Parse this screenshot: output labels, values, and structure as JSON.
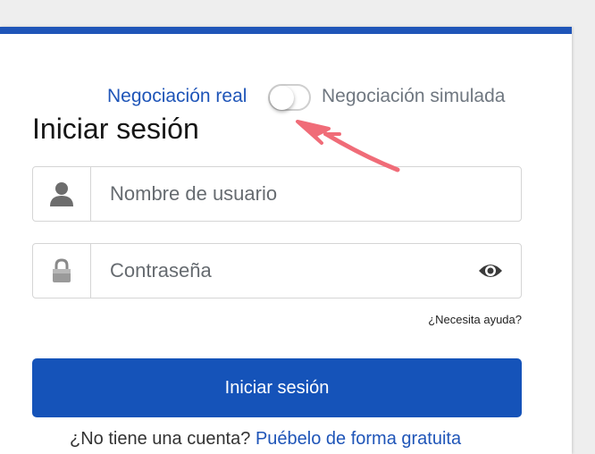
{
  "mode": {
    "real_label": "Negociación real",
    "simulated_label": "Negociación simulada",
    "toggle_on": false
  },
  "login": {
    "title": "Iniciar sesión",
    "username_placeholder": "Nombre de usuario",
    "password_placeholder": "Contraseña",
    "help_link": "¿Necesita ayuda?",
    "submit_label": "Iniciar sesión"
  },
  "signup": {
    "prompt": "¿No tiene una cuenta?",
    "link": "Puébelo de forma gratuita"
  },
  "colors": {
    "brand_blue": "#1553b9",
    "annotation_red": "#f06c78"
  },
  "icons": {
    "user": "user-icon",
    "lock": "lock-icon",
    "eye": "eye-icon",
    "arrow": "arrow-annotation"
  }
}
